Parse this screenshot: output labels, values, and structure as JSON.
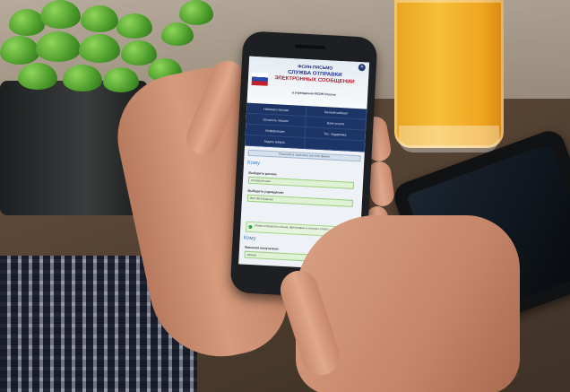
{
  "screen": {
    "header": {
      "line1": "ФСИН-ПИСЬМО",
      "line2": "СЛУЖБА ОТПРАВКИ",
      "line3": "ЭЛЕКТРОННЫХ СООБЩЕНИЙ",
      "line4": "",
      "line5": "в учреждения ФСИН России",
      "close_icon": "×"
    },
    "nav": [
      "Написать письмо",
      "Личный кабинет",
      "Оплатить письмо",
      "Банк услуги",
      "Информация",
      "Тех. поддержка",
      "Задать вопрос",
      ""
    ],
    "notice": "Пожалуйста, заполните все поля формы",
    "section_to": "Кому",
    "label_region": "Выберите регион:",
    "value_region": "Алтайский край",
    "label_institution": "Выберите учреждение:",
    "value_institution": "ФКУ ИК-5 Барнаул",
    "check_text": "Можно отправлять письма, фотографии и получать ответы",
    "section_from": "Кому",
    "label_surname": "Фамилия получателя:",
    "value_surname": "Иванов"
  }
}
